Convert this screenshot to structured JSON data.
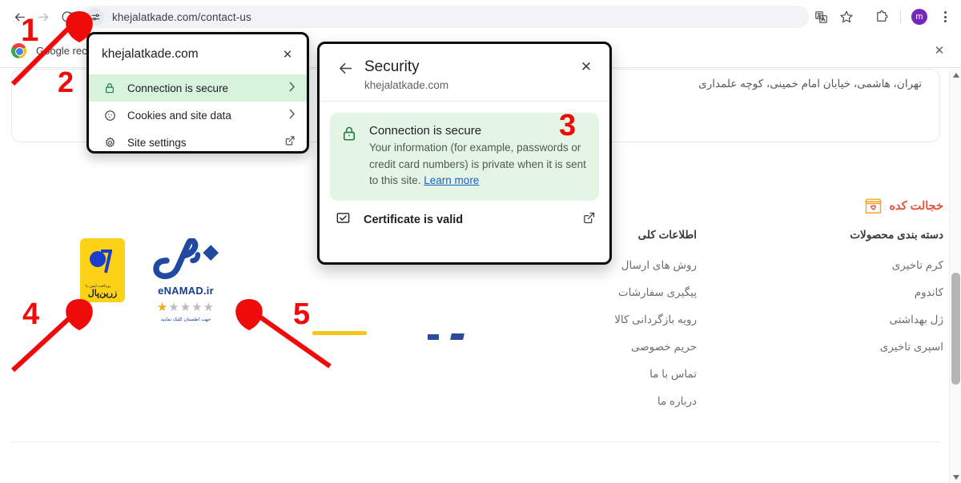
{
  "browser": {
    "back_label": "Back",
    "forward_label": "Forward",
    "reload_label": "Reload",
    "url": "khejalatkade.com/contact-us",
    "site_info_icon": "tune-icon",
    "translate_icon": "translate-icon",
    "bookmark_icon": "star-icon",
    "extensions_icon": "puzzle-icon",
    "profile_initial": "m",
    "profile_color": "#7627bb",
    "menu_icon": "three-dots-icon"
  },
  "notification": {
    "text": "Google reco",
    "close_label": "✕"
  },
  "site_popup": {
    "domain": "khejalatkade.com",
    "close_label": "✕",
    "rows": [
      {
        "label": "Connection is secure",
        "icon": "lock-icon",
        "trailing": "chevron-right-icon",
        "active": true
      },
      {
        "label": "Cookies and site data",
        "icon": "cookie-icon",
        "trailing": "chevron-right-icon",
        "active": false
      },
      {
        "label": "Site settings",
        "icon": "gear-icon",
        "trailing": "external-link-icon",
        "active": false
      }
    ]
  },
  "security_popup": {
    "back_label": "←",
    "title": "Security",
    "subtitle": "khejalatkade.com",
    "close_label": "✕",
    "secure_title": "Connection is secure",
    "secure_body": "Your information (for example, passwords or credit card numbers) is private when it is sent to this site. ",
    "learn_more": "Learn more",
    "certificate_label": "Certificate is valid",
    "lock_icon": "lock-icon",
    "certificate_icon": "checkbox-check-icon",
    "external_icon": "external-link-icon",
    "highlight_color": "#e4f5e6",
    "link_color": "#1a5ec4"
  },
  "page": {
    "address_line": "تهران، هاشمی، خیابان امام خمینی، کوچه علمداری",
    "brand_name": "خجالت کده",
    "brand_color": "#e8513a",
    "columns": [
      {
        "title": "دسته بندی محصولات",
        "items": [
          "کرم تاخیری",
          "کاندوم",
          "ژل بهداشتی",
          "اسپری تاخیری"
        ]
      },
      {
        "title": "اطلاعات کلی",
        "items": [
          "روش های ارسال",
          "پیگیری سفارشات",
          "رویه بازگردانی کالا",
          "حریم خصوصی",
          "تماس با ما",
          "درباره ما"
        ]
      }
    ],
    "badges": {
      "zarinpal": {
        "top_text": "پرداخت ایمن با",
        "name": "زرین‌پال",
        "bg_color": "#fcd116"
      },
      "enamad": {
        "label": "eNAMAD.ir",
        "stars_filled": 1,
        "stars_total": 5,
        "note": "جهت اطمینان کلیک نمایید",
        "color": "#173f8a"
      }
    }
  },
  "annotations": {
    "marker_color": "#f00b0b",
    "items": [
      {
        "number": "1",
        "target": "site-info-icon"
      },
      {
        "number": "2",
        "target": "connection-is-secure-row"
      },
      {
        "number": "3",
        "target": "security-panel"
      },
      {
        "number": "4",
        "target": "zarinpal-badge"
      },
      {
        "number": "5",
        "target": "enamad-badge"
      }
    ]
  }
}
